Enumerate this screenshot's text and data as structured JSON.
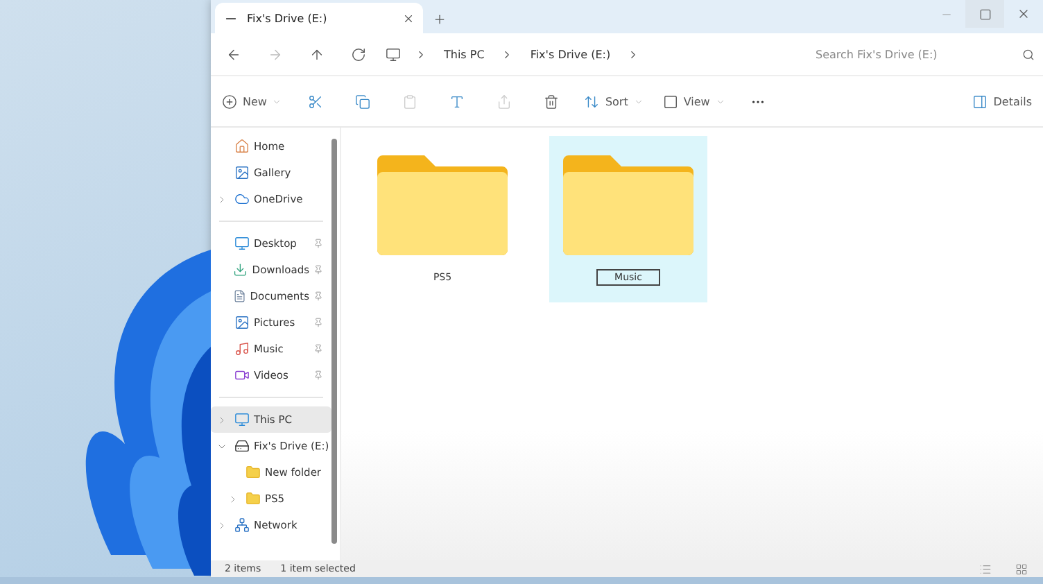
{
  "window": {
    "tab_title": "Fix's Drive (E:)"
  },
  "address": {
    "segments": [
      "This PC",
      "Fix's Drive (E:)"
    ],
    "search": {
      "placeholder": "Search Fix's Drive (E:)"
    }
  },
  "toolbar": {
    "new": "New",
    "sort": "Sort",
    "view": "View",
    "details": "Details"
  },
  "sidebar": {
    "groups": [
      [
        {
          "label": "Home",
          "pinned": false,
          "selected": false
        },
        {
          "label": "Gallery",
          "pinned": false,
          "selected": false
        },
        {
          "label": "OneDrive",
          "pinned": false,
          "expanded": false,
          "selected": false
        }
      ],
      [
        {
          "label": "Desktop",
          "pinned": true,
          "selected": false
        },
        {
          "label": "Downloads",
          "pinned": true,
          "selected": false
        },
        {
          "label": "Documents",
          "pinned": true,
          "selected": false
        },
        {
          "label": "Pictures",
          "pinned": true,
          "selected": false
        },
        {
          "label": "Music",
          "pinned": true,
          "selected": false
        },
        {
          "label": "Videos",
          "pinned": true,
          "selected": false
        }
      ],
      [
        {
          "label": "This PC",
          "pinned": false,
          "expanded": false,
          "selected": true
        },
        {
          "label": "Fix's Drive (E:)",
          "pinned": false,
          "expanded": true,
          "selected": false,
          "children": [
            {
              "label": "New folder",
              "pinned": false,
              "selected": false
            },
            {
              "label": "PS5",
              "pinned": false,
              "expanded": false,
              "selected": false
            }
          ]
        },
        {
          "label": "Network",
          "pinned": false,
          "expanded": false,
          "selected": false
        }
      ]
    ]
  },
  "files": [
    {
      "name": "PS5",
      "selected": false,
      "renaming": false
    },
    {
      "name": "Music",
      "selected": true,
      "renaming": true
    }
  ],
  "status_bar": {
    "count": "2 items",
    "selection": "1 item selected"
  }
}
